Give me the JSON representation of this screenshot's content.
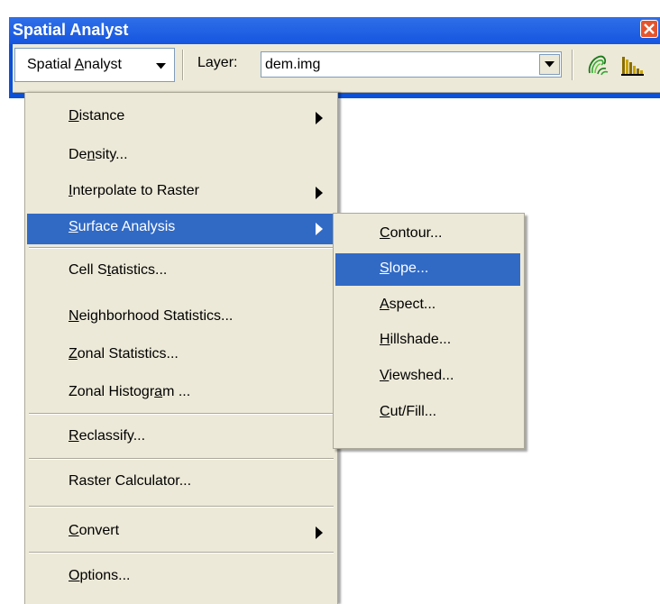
{
  "window": {
    "title": "Spatial Analyst",
    "close_icon": "close-icon"
  },
  "toolbar": {
    "menu_button": {
      "pre": "Spatial ",
      "mnemonic": "A",
      "post": "nalyst",
      "arrow_icon": "triangle-down-icon"
    },
    "layer_label": "Layer:",
    "layer_value": "dem.img",
    "tools": [
      "create-contours-icon",
      "histogram-icon"
    ]
  },
  "menu": {
    "items": [
      {
        "pre": "",
        "m": "D",
        "post": "istance",
        "submenu": true
      },
      {
        "pre": "De",
        "m": "n",
        "post": "sity...",
        "submenu": false
      },
      {
        "pre": "",
        "m": "I",
        "post": "nterpolate to Raster",
        "submenu": true
      },
      {
        "pre": "",
        "m": "S",
        "post": "urface Analysis",
        "submenu": true,
        "highlighted": true
      },
      {
        "pre": "Cell S",
        "m": "t",
        "post": "atistics...",
        "submenu": false
      },
      {
        "pre": "",
        "m": "N",
        "post": "eighborhood Statistics...",
        "submenu": false
      },
      {
        "pre": "",
        "m": "Z",
        "post": "onal Statistics...",
        "submenu": false
      },
      {
        "pre": "Zonal Histogr",
        "m": "a",
        "post": "m ...",
        "submenu": false
      },
      {
        "pre": "",
        "m": "R",
        "post": "eclassify...",
        "submenu": false
      },
      {
        "pre": "Raster Calculator...",
        "m": "",
        "post": "",
        "submenu": false
      },
      {
        "pre": "",
        "m": "C",
        "post": "onvert",
        "submenu": true
      },
      {
        "pre": "",
        "m": "O",
        "post": "ptions...",
        "submenu": false
      }
    ]
  },
  "submenu": {
    "items": [
      {
        "pre": "",
        "m": "C",
        "post": "ontour..."
      },
      {
        "pre": "",
        "m": "S",
        "post": "lope...",
        "highlighted": true
      },
      {
        "pre": "",
        "m": "A",
        "post": "spect..."
      },
      {
        "pre": "",
        "m": "H",
        "post": "illshade..."
      },
      {
        "pre": "",
        "m": "V",
        "post": "iewshed..."
      },
      {
        "pre": "",
        "m": "C",
        "post": "ut/Fill..."
      }
    ]
  },
  "colors": {
    "title_blue": "#0a50d8",
    "menu_bg": "#ece9d8",
    "highlight": "#316ac5"
  }
}
